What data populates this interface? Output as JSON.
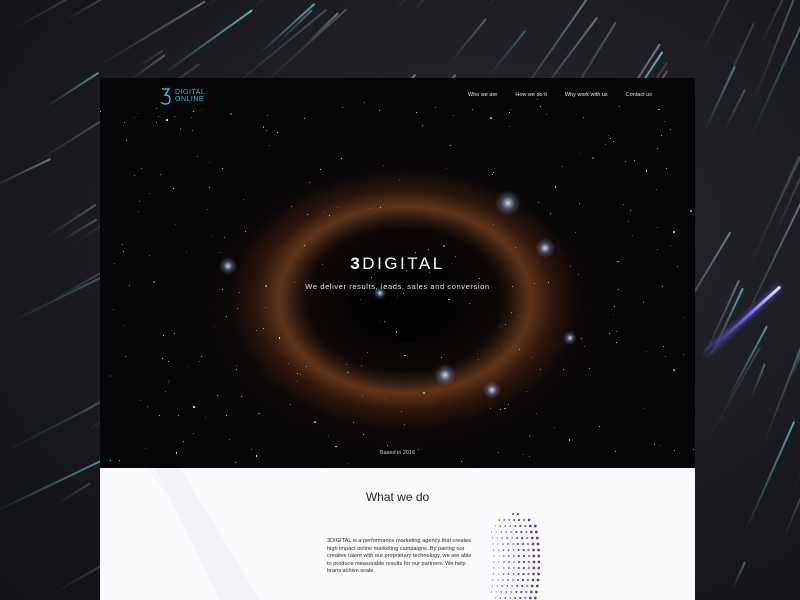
{
  "logo": {
    "line1": "DIGITAL",
    "line2": "ONLINE",
    "brand_color": "#2fc0d6"
  },
  "nav": {
    "items": [
      "Who we are",
      "How we do it",
      "Why work with us",
      "Contact us"
    ]
  },
  "hero": {
    "title_num": "3",
    "title_word": "DIGITAL",
    "subtitle": "We deliver results, leads, sales and conversion",
    "based": "Based in 2016"
  },
  "about": {
    "title": "What we do",
    "body": "3DIGITAL is a performance marketing agency that creates high impact online marketing campaigns. By pairing our creative talent with our proprietary technology, we are able to produce measurable results for our partners. We help brans achive scale."
  },
  "colors": {
    "accent_teal": "#2fc0d6",
    "accent_violet": "#7f6bff"
  }
}
